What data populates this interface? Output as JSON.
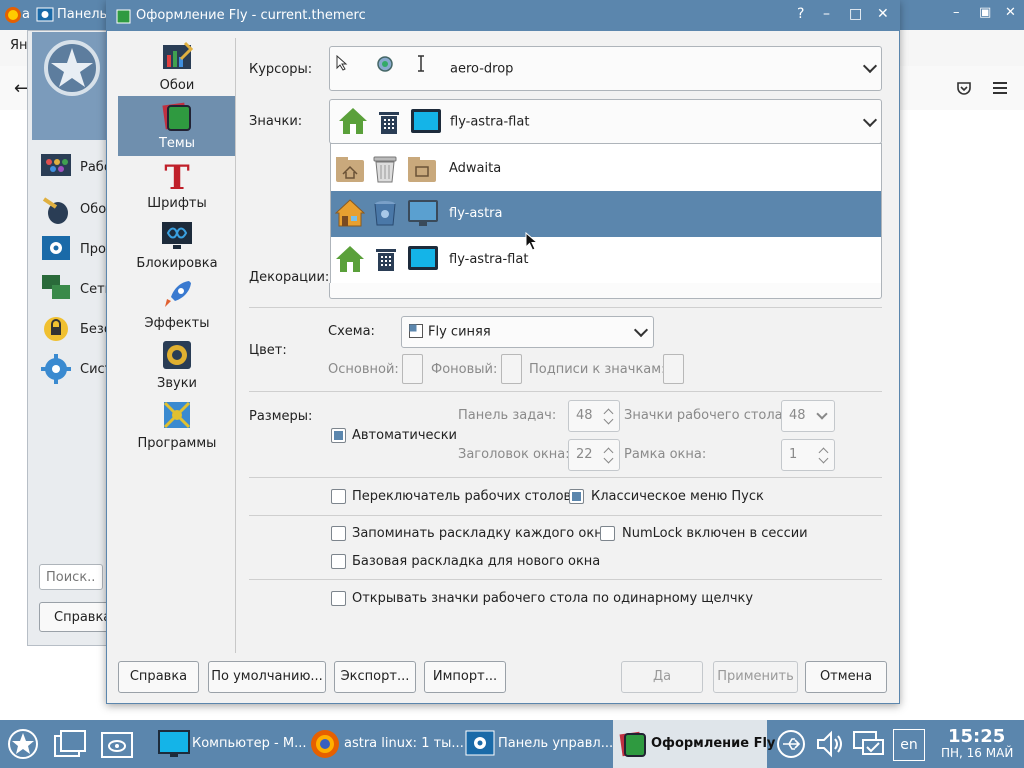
{
  "top_bar": {
    "bg_window_title": "Панель",
    "bg_window_letter": "а"
  },
  "browser": {
    "bookmark_text": "Янд"
  },
  "control_panel": {
    "items": [
      {
        "label": "Рабо",
        "icon": "desktop-icon"
      },
      {
        "label": "Обо",
        "icon": "mouse-icon"
      },
      {
        "label": "Про",
        "icon": "settings-screen-icon"
      },
      {
        "label": "Сеть",
        "icon": "network-icon"
      },
      {
        "label": "Безо",
        "icon": "security-icon"
      },
      {
        "label": "Сист",
        "icon": "gear-icon"
      }
    ],
    "search_placeholder": "Поиск...",
    "help_label": "Справка"
  },
  "dialog": {
    "title": "Оформление Fly - current.themerc",
    "sidebar": [
      {
        "label": "Обои",
        "icon": "wallpaper-icon"
      },
      {
        "label": "Темы",
        "icon": "themes-icon"
      },
      {
        "label": "Шрифты",
        "icon": "fonts-icon"
      },
      {
        "label": "Блокировка",
        "icon": "lock-screen-icon"
      },
      {
        "label": "Эффекты",
        "icon": "rocket-icon"
      },
      {
        "label": "Звуки",
        "icon": "speaker-icon"
      },
      {
        "label": "Программы",
        "icon": "programs-icon"
      }
    ],
    "cursors_label": "Курсоры:",
    "cursors_value": "aero-drop",
    "icons_label": "Значки:",
    "icons_value": "fly-astra-flat",
    "icons_options": [
      "Adwaita",
      "fly-astra",
      "fly-astra-flat"
    ],
    "decorations_label": "Декорации:",
    "color_label": "Цвет:",
    "scheme_label": "Схема:",
    "scheme_value": "Fly синяя",
    "main_color_label": "Основной:",
    "bg_color_label": "Фоновый:",
    "icon_caption_label": "Подписи к значкам:",
    "sizes_label": "Размеры:",
    "auto_label": "Автоматически",
    "taskbar_label": "Панель задач:",
    "taskbar_value": "48",
    "desktop_icons_label": "Значки рабочего стола:",
    "desktop_icons_value": "48",
    "window_title_label": "Заголовок окна:",
    "window_title_value": "22",
    "window_frame_label": "Рамка окна:",
    "window_frame_value": "1",
    "cb_workspace_switch": "Переключатель рабочих столов",
    "cb_classic_menu": "Классическое меню Пуск",
    "cb_remember_layout": "Запоминать раскладку каждого окна",
    "cb_numlock": "NumLock включен в сессии",
    "cb_base_layout": "Базовая раскладка для нового окна",
    "cb_single_click": "Открывать значки рабочего стола по одинарному щелчку",
    "buttons": {
      "help": "Справка",
      "defaults": "По умолчанию...",
      "export": "Экспорт...",
      "import": "Импорт...",
      "ok": "Да",
      "apply": "Применить",
      "cancel": "Отмена"
    }
  },
  "taskbar": {
    "tasks": [
      {
        "label": "Компьютер - М..."
      },
      {
        "label": "astra linux: 1 ты..."
      },
      {
        "label": "Панель управл..."
      },
      {
        "label": "Оформление Fly"
      }
    ],
    "lang": "en",
    "time": "15:25",
    "date": "ПН, 16 МАЙ"
  },
  "colors": {
    "accent": "#5b86ad",
    "highlight": "#6f8fae"
  }
}
